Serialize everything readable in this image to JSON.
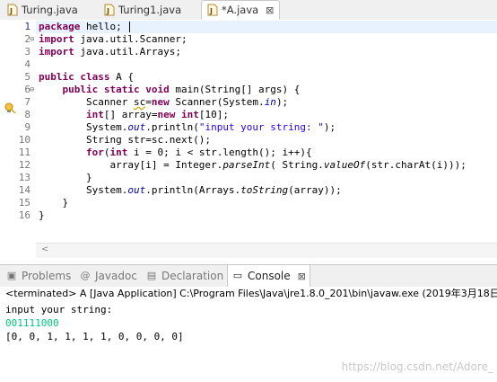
{
  "editor_tabs": [
    {
      "label": "Turing.java",
      "active": false
    },
    {
      "label": "Turing1.java",
      "active": false
    },
    {
      "label": "*A.java",
      "active": true
    }
  ],
  "editor": {
    "line_numbers": [
      "1",
      "2",
      "3",
      "4",
      "5",
      "6",
      "7",
      "8",
      "9",
      "10",
      "11",
      "12",
      "13",
      "14",
      "15",
      "16"
    ],
    "lines": [
      [
        {
          "t": "package",
          "c": "kw"
        },
        {
          "t": " hello;"
        }
      ],
      [
        {
          "t": "import",
          "c": "kw"
        },
        {
          "t": " java.util.Scanner;"
        }
      ],
      [
        {
          "t": "import",
          "c": "kw"
        },
        {
          "t": " java.util.Arrays;"
        }
      ],
      [
        {
          "t": ""
        }
      ],
      [
        {
          "t": "public class",
          "c": "kw"
        },
        {
          "t": " A {"
        }
      ],
      [
        {
          "t": "    "
        },
        {
          "t": "public static void",
          "c": "kw"
        },
        {
          "t": " main(String[] args) {"
        }
      ],
      [
        {
          "t": "        Scanner "
        },
        {
          "t": "sc",
          "c": "warn-ul"
        },
        {
          "t": "="
        },
        {
          "t": "new",
          "c": "kw"
        },
        {
          "t": " Scanner(System."
        },
        {
          "t": "in",
          "c": "fld"
        },
        {
          "t": ");"
        }
      ],
      [
        {
          "t": "        "
        },
        {
          "t": "int",
          "c": "kw"
        },
        {
          "t": "[] array="
        },
        {
          "t": "new",
          "c": "kw"
        },
        {
          "t": " "
        },
        {
          "t": "int",
          "c": "kw"
        },
        {
          "t": "[10];"
        }
      ],
      [
        {
          "t": "        System."
        },
        {
          "t": "out",
          "c": "fld"
        },
        {
          "t": ".println("
        },
        {
          "t": "\"input your string: \"",
          "c": "str"
        },
        {
          "t": ");"
        }
      ],
      [
        {
          "t": "        String str=sc.next();"
        }
      ],
      [
        {
          "t": "        "
        },
        {
          "t": "for",
          "c": "kw"
        },
        {
          "t": "("
        },
        {
          "t": "int",
          "c": "kw"
        },
        {
          "t": " i = 0; i < str.length(); i++){"
        }
      ],
      [
        {
          "t": "            array[i] = Integer."
        },
        {
          "t": "parseInt",
          "c": "ital"
        },
        {
          "t": "( String."
        },
        {
          "t": "valueOf",
          "c": "ital"
        },
        {
          "t": "(str.charAt(i)));"
        }
      ],
      [
        {
          "t": "        }"
        }
      ],
      [
        {
          "t": "        System."
        },
        {
          "t": "out",
          "c": "fld"
        },
        {
          "t": ".println(Arrays."
        },
        {
          "t": "toString",
          "c": "ital"
        },
        {
          "t": "(array));"
        }
      ],
      [
        {
          "t": "    }"
        }
      ],
      [
        {
          "t": "}"
        }
      ]
    ],
    "fold_markers": [
      "",
      "⊖",
      "",
      "",
      "",
      "⊖",
      "",
      "",
      "",
      "",
      "",
      "",
      "",
      "",
      "",
      ""
    ],
    "scroll_left_glyph": "<"
  },
  "view_tabs": [
    {
      "label": "Problems",
      "icon": "problems-icon",
      "glyph": "▣",
      "active": false
    },
    {
      "label": "Javadoc",
      "icon": "javadoc-icon",
      "glyph": "@",
      "active": false
    },
    {
      "label": "Declaration",
      "icon": "declaration-icon",
      "glyph": "▤",
      "active": false
    },
    {
      "label": "Console",
      "icon": "console-icon",
      "glyph": "▭",
      "active": true,
      "close": "⊠"
    }
  ],
  "console": {
    "status": "<terminated> A [Java Application] C:\\Program Files\\Java\\jre1.8.0_201\\bin\\javaw.exe (2019年3月18日",
    "lines": [
      {
        "text": "input your string:",
        "kind": "output"
      },
      {
        "text": "001111000",
        "kind": "input"
      },
      {
        "text": "[0, 0, 1, 1, 1, 1, 0, 0, 0, 0]",
        "kind": "output"
      }
    ]
  },
  "watermark": "https://blog.csdn.net/Adore_",
  "colors": {
    "keyword": "#7f0055",
    "string": "#2a00ff",
    "field": "#0000c0",
    "console_input": "#00c87d"
  }
}
